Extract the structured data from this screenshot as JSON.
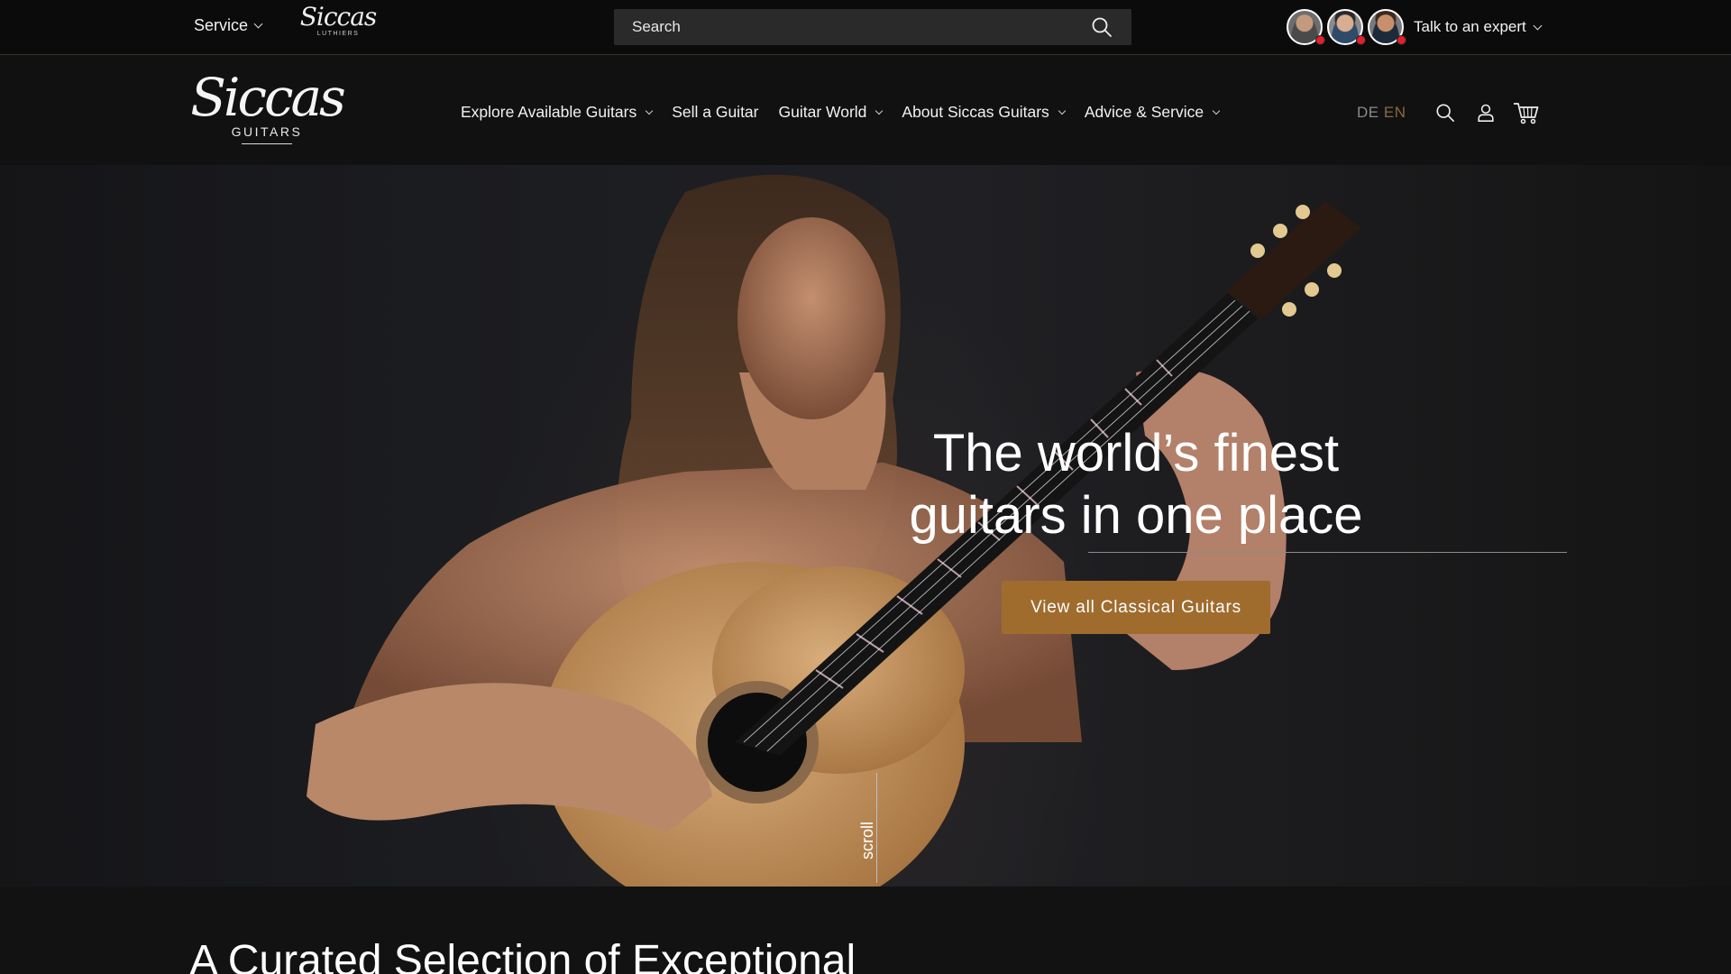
{
  "topbar": {
    "service_label": "Service",
    "luthiers_logo": {
      "script": "Siccas",
      "sub": "LUTHIERS"
    },
    "search": {
      "placeholder": "Search"
    },
    "expert_label": "Talk to an expert"
  },
  "header": {
    "logo": {
      "script": "Siccas",
      "sub": "GUITARS"
    },
    "nav": [
      {
        "label": "Explore Available Guitars",
        "dropdown": true
      },
      {
        "label": "Sell a Guitar",
        "dropdown": false
      },
      {
        "label": "Guitar World",
        "dropdown": true
      },
      {
        "label": "About Siccas Guitars",
        "dropdown": true
      },
      {
        "label": "Advice & Service",
        "dropdown": true
      }
    ],
    "lang": {
      "de": "DE",
      "en": "EN",
      "active": "EN"
    },
    "icons": [
      "search-icon",
      "account-icon",
      "cart-icon"
    ]
  },
  "hero": {
    "title_line1": "The world’s finest",
    "title_line2": "guitars in one place",
    "cta_label": "View all Classical Guitars",
    "scroll_label": "scroll"
  },
  "section": {
    "heading": "A Curated Selection of Exceptional"
  },
  "colors": {
    "accent": "#a06c2e",
    "lang_active": "#8a6a3a",
    "online_dot": "#e0202a",
    "topbar_bg": "#0b0b0b",
    "header_bg": "#111111"
  }
}
